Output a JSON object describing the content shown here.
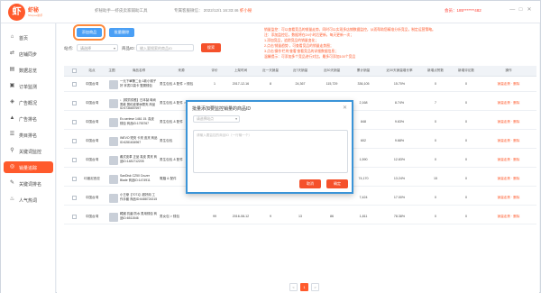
{
  "header": {
    "logo_mark": "虾",
    "logo_name": "虾秘",
    "logo_sub": "Shopee助手",
    "tip": "虾秘助手—虾皮卖家辅助工具",
    "status_prefix": "专属客服微信：",
    "status_time": "2022/12/1 16:33:46",
    "status_highlight": "虾小秘",
    "user": "会员：185*******482",
    "win_min": "—",
    "win_max": "□",
    "win_close": "✕"
  },
  "sidebar": {
    "items": [
      {
        "icon": "⌂",
        "icon_name": "home-icon",
        "label": "首页"
      },
      {
        "icon": "⇄",
        "icon_name": "sync-icon",
        "label": "店铺同步"
      },
      {
        "icon": "▤",
        "icon_name": "chart-icon",
        "label": "数据总览"
      },
      {
        "icon": "▣",
        "icon_name": "order-icon",
        "label": "订单监测"
      },
      {
        "icon": "◈",
        "icon_name": "ad-icon",
        "label": "广告概况"
      },
      {
        "icon": "▲",
        "icon_name": "ad-trend-icon",
        "label": "广告排名"
      },
      {
        "icon": "☰",
        "icon_name": "category-icon",
        "label": "类目排名"
      },
      {
        "icon": "⚲",
        "icon_name": "keyword-monitor-icon",
        "label": "关键词监控"
      },
      {
        "icon": "◎",
        "icon_name": "sales-trace-icon",
        "label": "销量追踪"
      },
      {
        "icon": "✎",
        "icon_name": "keyword-rank-icon",
        "label": "关键词排名"
      },
      {
        "icon": "♨",
        "icon_name": "hot-words-icon",
        "label": "人气热词"
      }
    ],
    "active_index": 8
  },
  "toolbar": {
    "add_button": "添加商品",
    "batch_button": "批量删除",
    "site_label": "站点:",
    "site_select": "请选择",
    "id_label": "商品ID:",
    "id_placeholder": "输入要搜索的商品ID",
    "search_button": "搜索"
  },
  "notice": [
    "销量监控：可以查看竞品的销量走势，同时可以实现多店铺数据监控，从而帮助您精准分析竞品，制定运营策略。",
    "注：添加监控后，数据将在24小时后更新，每天更新一次；",
    "1.添加竞品，追踪竞品的销量变化；",
    "2.点击'销量趋势'，可查看竞品的销量走势图；",
    "3.点击'操作'栏的'查看'查看竞品的详细数据信息；",
    "温馨提示：可添加多个竞品进行对比，最多可添加100个竞品"
  ],
  "table": {
    "headers": [
      "站点",
      "主图",
      "商品名称",
      "来源",
      "评价",
      "上架时间",
      "近一天销量",
      "近7天销量",
      "近30天销量",
      "累计销量",
      "近30天销量增长率",
      "新增点赞数",
      "新增评论数",
      "操作"
    ],
    "rows": [
      {
        "site": "中国台湾",
        "name": "一元下單賺二台 1款小錢子好 拿書口袋卡 雙層錢包",
        "source": "男生包包 & 配件 > 錢包",
        "rating": "1",
        "date": "2017-12-16",
        "d1": "8",
        "d7": "24,367",
        "d30": "115,729",
        "total": "336,105",
        "growth": "15.70%",
        "likes": "0",
        "comments": "0",
        "op": "销量走势 · 删除"
      },
      {
        "site": "中国台湾",
        "name": "↓【現貨供應】日本製 時尚男款 簡約皮革休閒夾 商品ID:5736657697",
        "source": "男生包包 & 配件 > 錢包",
        "rating": "",
        "date": "",
        "d1": "",
        "d7": "",
        "d30": "",
        "total": "2,168",
        "growth": "8.74%",
        "likes": "7",
        "comments": "0",
        "op": "销量走势 · 删除"
      },
      {
        "site": "中国台湾",
        "name": "Ex-seriese 1461 15. 真皮 錢包 商品ID:1753767",
        "source": "男生包包 & 配件",
        "rating": "",
        "date": "",
        "d1": "",
        "d7": "",
        "d30": "",
        "total": "848",
        "growth": "9.63%",
        "likes": "0",
        "comments": "0",
        "op": "销量走势 · 删除"
      },
      {
        "site": "中国台湾",
        "name": "INEVO 短夾 卡夾 皮夾 商品ID:6281634967",
        "source": "男生包包",
        "rating": "",
        "date": "",
        "d1": "",
        "d7": "",
        "d30": "",
        "total": "602",
        "growth": "9.68%",
        "likes": "0",
        "comments": "0",
        "op": "销量走势 · 删除"
      },
      {
        "site": "中国台湾",
        "name": "義式皮革 正品 真皮 男夾 商品ID:1481712205",
        "source": "男生包包 & 配件",
        "rating": "",
        "date": "",
        "d1": "",
        "d7": "",
        "d30": "",
        "total": "1,590",
        "growth": "12.83%",
        "likes": "0",
        "comments": "0",
        "op": "销量走势 · 删除"
      },
      {
        "site": "印度尼西亚",
        "name": "SanDisk CZ50 Cruzer Blade 商品ID:1474911",
        "source": "電腦 & 配件",
        "rating": "",
        "date": "",
        "d1": "",
        "d7": "",
        "d30": "",
        "total": "74,170",
        "growth": "13.24%",
        "likes": "15",
        "comments": "0",
        "op": "销量走势 · 删除"
      },
      {
        "site": "中国台湾",
        "name": "小王爺【7071】超好用 工作手套 商品ID:6488724315",
        "source": "",
        "rating": "",
        "date": "",
        "d1": "",
        "d7": "",
        "d30": "",
        "total": "7,424",
        "growth": "17.00%",
        "likes": "0",
        "comments": "0",
        "op": "销量走势 · 删除"
      },
      {
        "site": "中国台湾",
        "name": "韓國 抗菌 防水 男用錢包 商品ID:6511546",
        "source": "男女包 > 錢包",
        "rating": "99",
        "date": "2016-08-12",
        "d1": "9",
        "d7": "13",
        "d30": "86",
        "total": "1,811",
        "growth": "78.38%",
        "likes": "0",
        "comments": "0",
        "op": "销量走势 · 删除"
      }
    ]
  },
  "modal": {
    "title": "批量添加要监控销量的商品ID",
    "close": "✕",
    "site_select": "请选择站点",
    "textarea_placeholder": "请输入要监控的商品ID（一行输一个）",
    "cancel": "取消",
    "confirm": "确定"
  },
  "pager": {
    "prev": "<",
    "current": "1",
    "next": ">"
  },
  "colors": {
    "accent": "#ff5a2c",
    "blue": "#4a9ff5",
    "modal_border": "#3a94d8"
  }
}
